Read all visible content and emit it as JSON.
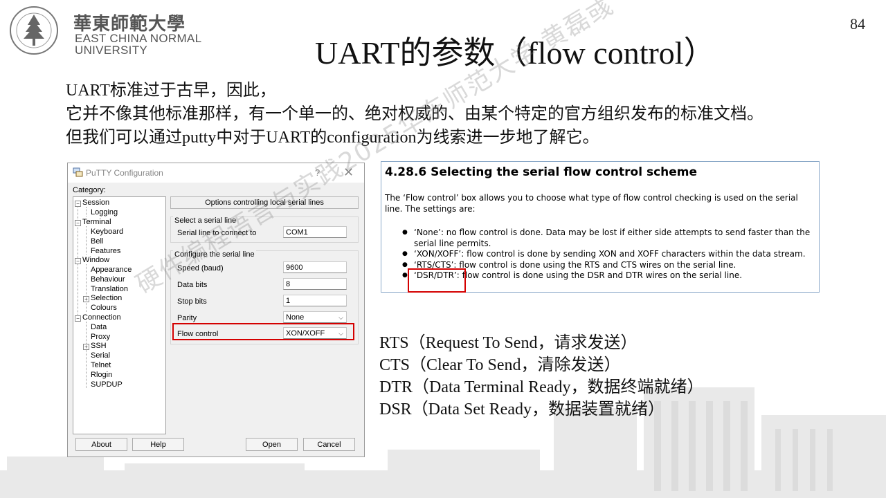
{
  "slide": {
    "page_number": "84",
    "title": "UART的参数（flow control）"
  },
  "logo": {
    "cn_name": "華東師範大學",
    "en_line1": "EAST CHINA NORMAL",
    "en_line2": "UNIVERSITY",
    "seal_text": "EAST CHINA NORMAL UNIVERSITY"
  },
  "body": {
    "lines": [
      "UART标准过于古早，因此，",
      "它并不像其他标准那样，有一个单一的、绝对权威的、由某个特定的官方组织发布的标准文档。",
      "但我们可以通过putty中对于UART的configuration为线索进一步地了解它。"
    ]
  },
  "putty": {
    "window_title": "PuTTY Configuration",
    "help_glyph": "?",
    "close_glyph": "✕",
    "category_label": "Category:",
    "tree": [
      {
        "label": "Session",
        "level": 0,
        "box": "−"
      },
      {
        "label": "Logging",
        "level": 1
      },
      {
        "label": "Terminal",
        "level": 0,
        "box": "−"
      },
      {
        "label": "Keyboard",
        "level": 1
      },
      {
        "label": "Bell",
        "level": 1
      },
      {
        "label": "Features",
        "level": 1
      },
      {
        "label": "Window",
        "level": 0,
        "box": "−"
      },
      {
        "label": "Appearance",
        "level": 1
      },
      {
        "label": "Behaviour",
        "level": 1
      },
      {
        "label": "Translation",
        "level": 1
      },
      {
        "label": "Selection",
        "level": 1,
        "box": "+"
      },
      {
        "label": "Colours",
        "level": 1
      },
      {
        "label": "Connection",
        "level": 0,
        "box": "−"
      },
      {
        "label": "Data",
        "level": 1
      },
      {
        "label": "Proxy",
        "level": 1
      },
      {
        "label": "SSH",
        "level": 1,
        "box": "+"
      },
      {
        "label": "Serial",
        "level": 1
      },
      {
        "label": "Telnet",
        "level": 1
      },
      {
        "label": "Rlogin",
        "level": 1
      },
      {
        "label": "SUPDUP",
        "level": 1
      }
    ],
    "panel_header": "Options controlling local serial lines",
    "group_select": "Select a serial line",
    "serial_line_label": "Serial line to connect to",
    "serial_line_value": "COM1",
    "group_configure": "Configure the serial line",
    "speed_label": "Speed (baud)",
    "speed_value": "9600",
    "data_bits_label": "Data bits",
    "data_bits_value": "8",
    "stop_bits_label": "Stop bits",
    "stop_bits_value": "1",
    "parity_label": "Parity",
    "parity_value": "None",
    "flow_label": "Flow control",
    "flow_value": "XON/XOFF",
    "buttons": {
      "about": "About",
      "help": "Help",
      "open": "Open",
      "cancel": "Cancel"
    }
  },
  "doc": {
    "heading": "4.28.6 Selecting the serial flow control scheme",
    "para": "The ‘Flow control’ box allows you to choose what type of flow control checking is used on the serial line. The settings are:",
    "items": [
      {
        "term": "‘None’",
        "desc": ": no flow control is done. Data may be lost if either side attempts to send faster than the serial line permits."
      },
      {
        "term": "‘XON/XOFF’",
        "desc": ": flow control is done by sending XON and XOFF characters within the data stream."
      },
      {
        "term": "‘RTS/CTS’",
        "desc": ": flow control is done using the RTS and CTS wires on the serial line."
      },
      {
        "term": "‘DSR/DTR’",
        "desc": ": flow control is done using the DSR and DTR wires on the serial line."
      }
    ]
  },
  "signals": [
    "RTS（Request To Send，请求发送）",
    "CTS（Clear To Send，清除发送）",
    "DTR（Data Terminal Ready，数据终端就绪）",
    "DSR（Data Set Ready，数据装置就绪）"
  ],
  "watermark": "硬件编程语言与实践2025华东师范大学 黄磊彧",
  "colors": {
    "highlight_red": "#d40000",
    "doc_border": "#8aa8c8"
  }
}
